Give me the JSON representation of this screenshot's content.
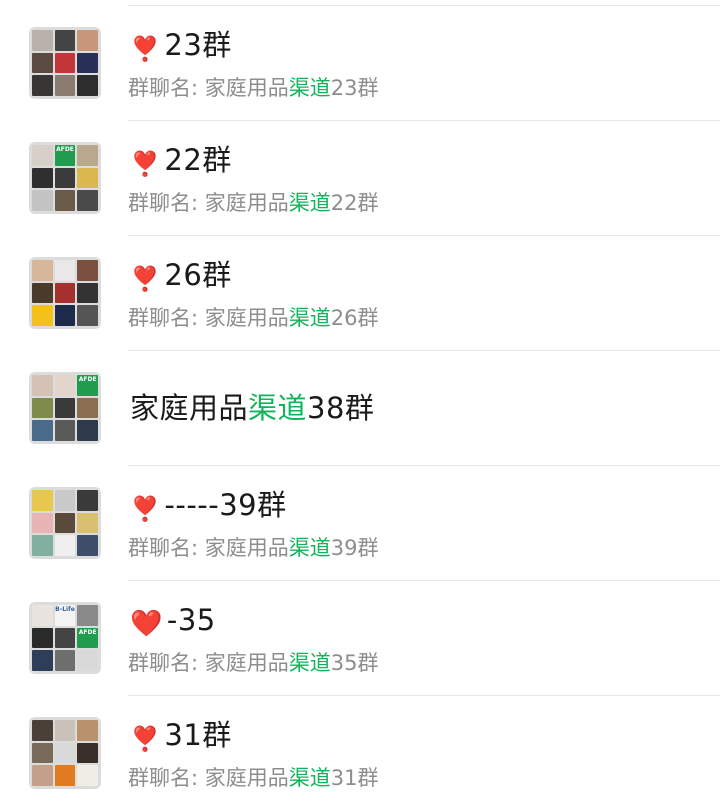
{
  "chats": [
    {
      "emoji": "❣️",
      "title": "23群",
      "subtitle": {
        "prefix": "群聊名: 家庭用品",
        "highlight": "渠道",
        "suffix": "23群"
      }
    },
    {
      "emoji": "❣️",
      "title": "22群",
      "subtitle": {
        "prefix": "群聊名: 家庭用品",
        "highlight": "渠道",
        "suffix": "22群"
      }
    },
    {
      "emoji": "❣️",
      "title": "26群",
      "subtitle": {
        "prefix": "群聊名: 家庭用品",
        "highlight": "渠道",
        "suffix": "26群"
      }
    },
    {
      "title_prefix": "家庭用品",
      "title_highlight": "渠道",
      "title_suffix": "38群"
    },
    {
      "emoji": "❣️",
      "title": "-----39群",
      "subtitle": {
        "prefix": "群聊名: 家庭用品",
        "highlight": "渠道",
        "suffix": "39群"
      }
    },
    {
      "emoji": "❤️",
      "title": "-35",
      "subtitle": {
        "prefix": "群聊名: 家庭用品",
        "highlight": "渠道",
        "suffix": "35群"
      }
    },
    {
      "emoji": "❣️",
      "title": "31群",
      "subtitle": {
        "prefix": "群聊名: 家庭用品",
        "highlight": "渠道",
        "suffix": "31群"
      }
    }
  ],
  "avatar_labels": [
    "AFDE",
    "AFDE",
    "AFDE",
    "B-Life"
  ],
  "colors": {
    "highlight": "#12b35a",
    "title": "#1a1a1a",
    "subtitle": "#8d8d8d",
    "divider": "#e6e6e6",
    "heart": "#e4141b"
  }
}
